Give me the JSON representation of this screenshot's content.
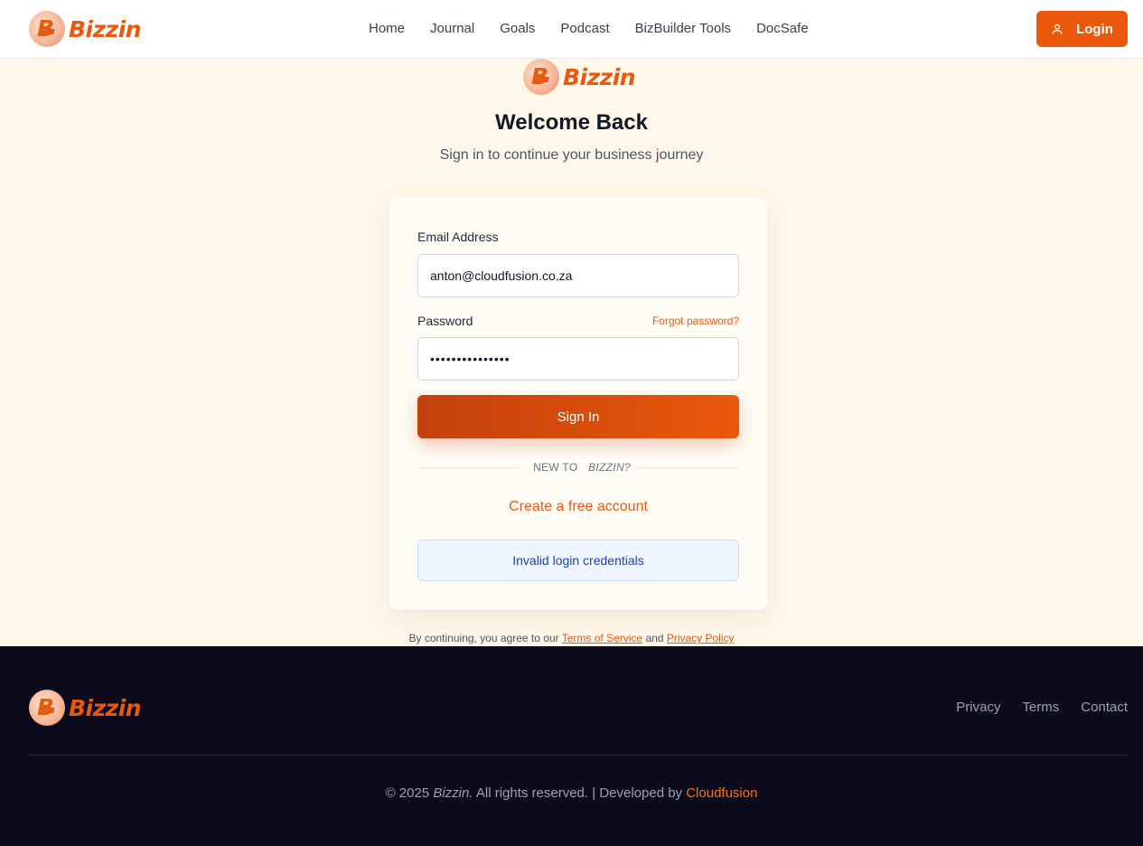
{
  "brand": {
    "name": "Bizzin",
    "color": "#ea580c"
  },
  "nav": {
    "items": [
      "Home",
      "Journal",
      "Goals",
      "Podcast",
      "BizBuilder Tools",
      "DocSafe"
    ],
    "login_label": "Login"
  },
  "hero": {
    "title": "Welcome Back",
    "subtitle": "Sign in to continue your business journey"
  },
  "form": {
    "email_label": "Email Address",
    "email_value": "anton@cloudfusion.co.za",
    "password_label": "Password",
    "password_value": "•••••••••••••••",
    "forgot_label": "Forgot password?",
    "signin_label": "Sign In",
    "divider_prefix": "NEW TO",
    "divider_brand": "BIZZIN?",
    "create_label": "Create a free account",
    "error_message": "Invalid login credentials"
  },
  "terms": {
    "prefix": "By continuing, you agree to our",
    "tos": "Terms of Service",
    "and": "and",
    "privacy": "Privacy Policy"
  },
  "footer": {
    "links": [
      "Privacy",
      "Terms",
      "Contact"
    ],
    "copyright_prefix": "© 2025",
    "copyright_brand": "Bizzin.",
    "copyright_rest": "All rights reserved.",
    "developed_by": "| Developed by",
    "developer": "Cloudfusion"
  },
  "icons": {
    "login": "user-icon",
    "logo": "bizzin-logo-icon"
  }
}
